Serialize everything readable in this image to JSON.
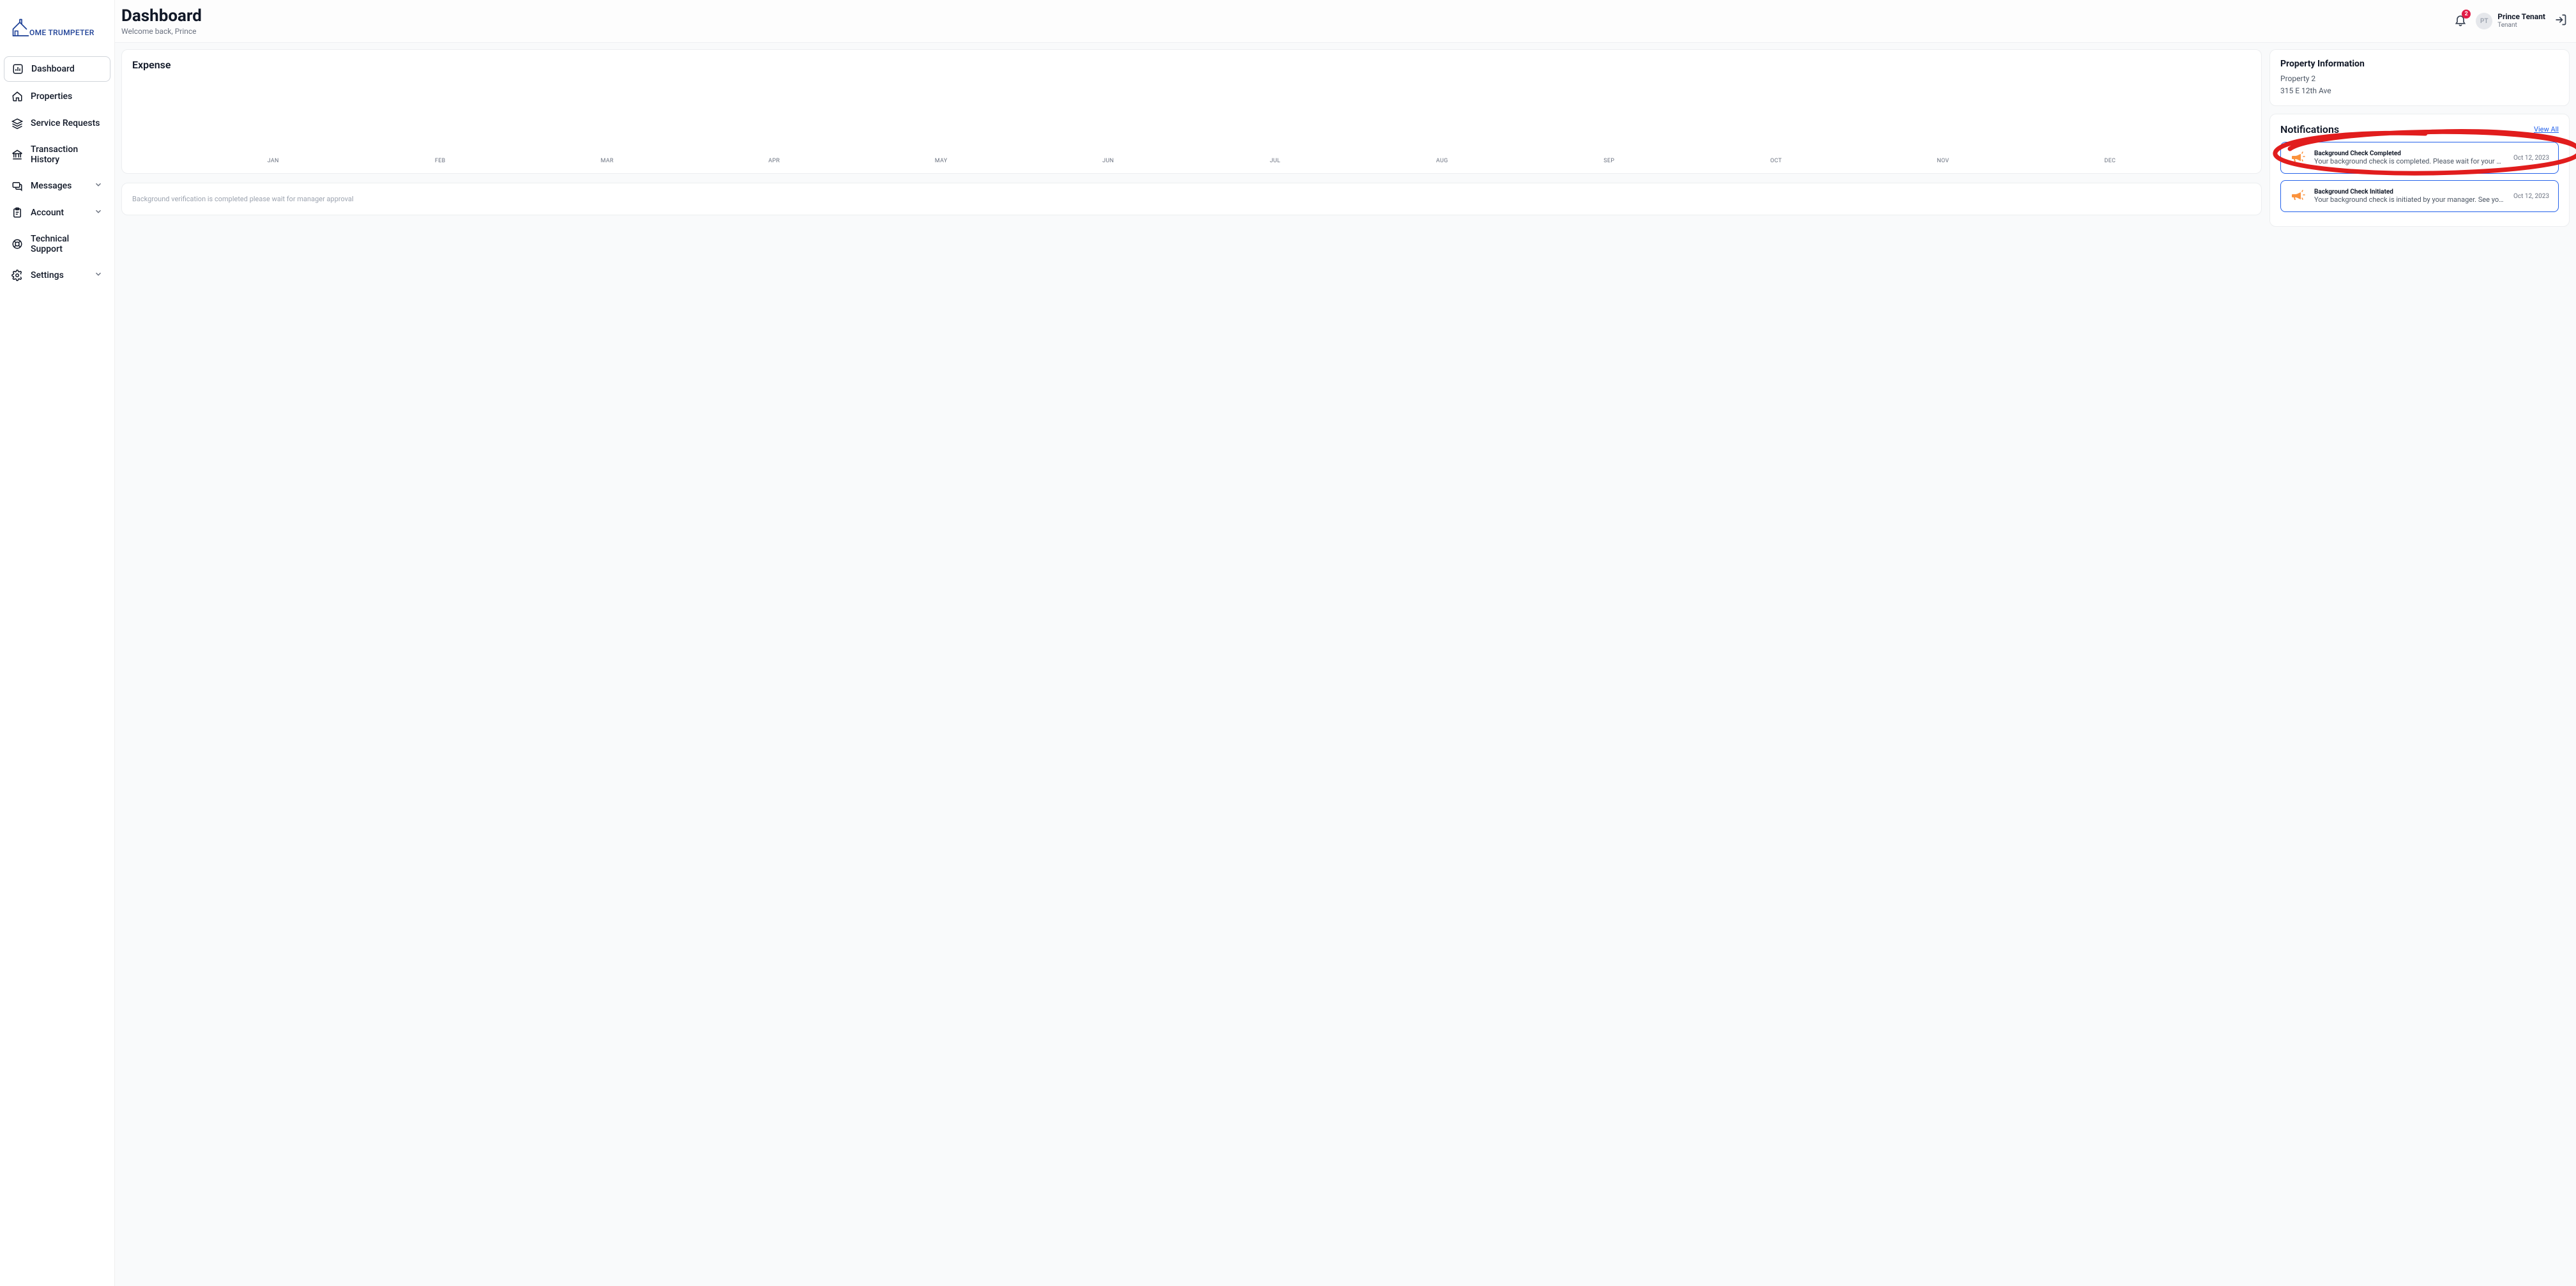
{
  "brand": {
    "name": "OME TRUMPETER"
  },
  "nav": {
    "dashboard": "Dashboard",
    "properties": "Properties",
    "service": "Service Requests",
    "transactions": "Transaction History",
    "messages": "Messages",
    "account": "Account",
    "support": "Technical Support",
    "settings": "Settings"
  },
  "header": {
    "title": "Dashboard",
    "subtitle": "Welcome back, Prince",
    "badge_count": "2",
    "user_name": "Prince Tenant",
    "user_role": "Tenant",
    "avatar_initials": "PT"
  },
  "expense": {
    "title": "Expense"
  },
  "chart_data": {
    "type": "bar",
    "categories": [
      "JAN",
      "FEB",
      "MAR",
      "APR",
      "MAY",
      "JUN",
      "JUL",
      "AUG",
      "SEP",
      "OCT",
      "NOV",
      "DEC"
    ],
    "values": [
      0,
      0,
      0,
      0,
      0,
      0,
      0,
      0,
      0,
      0,
      0,
      0
    ],
    "title": "Expense",
    "xlabel": "",
    "ylabel": "",
    "ylim": [
      0,
      0
    ]
  },
  "status_banner": "Background verification is completed please wait for manager approval",
  "property": {
    "heading": "Property Information",
    "name": "Property 2",
    "address": "315 E 12th Ave"
  },
  "notifications": {
    "heading": "Notifications",
    "view_all": "View All",
    "items": [
      {
        "title": "Background Check Completed",
        "message": "Your background check is completed. Please wait for your manager approval.",
        "date": "Oct 12, 2023"
      },
      {
        "title": "Background Check Initiated",
        "message": "Your background check is initiated by your manager. See your email for furt…",
        "date": "Oct 12, 2023"
      }
    ]
  }
}
